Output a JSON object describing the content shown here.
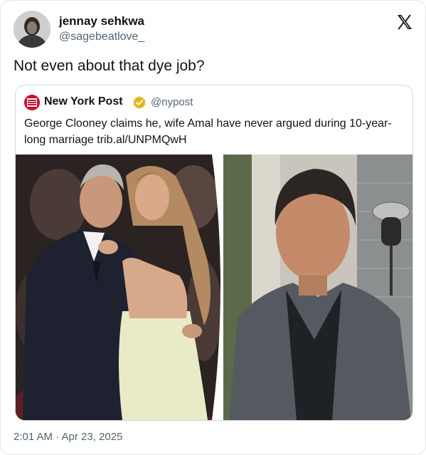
{
  "author": {
    "name": "jennay sehkwa",
    "handle": "@sagebeatlove_"
  },
  "icons": {
    "platform": "x-logo-icon",
    "verified": "verified-badge-icon"
  },
  "tweet": {
    "text": "Not even about that dye job?",
    "timestamp": "2:01 AM · Apr 23, 2025"
  },
  "quoted": {
    "name": "New York Post",
    "handle": "@nypost",
    "text": "George Clooney claims he, wife Amal have never argued during 10-year-long marriage trib.al/UNPMQwH",
    "logo_text": "NEW YORK POST"
  },
  "colors": {
    "text": "#0f1419",
    "secondary": "#536471",
    "border": "#cfd9de",
    "nypost_red": "#c8102e",
    "verified_gold": "#e2b719"
  }
}
